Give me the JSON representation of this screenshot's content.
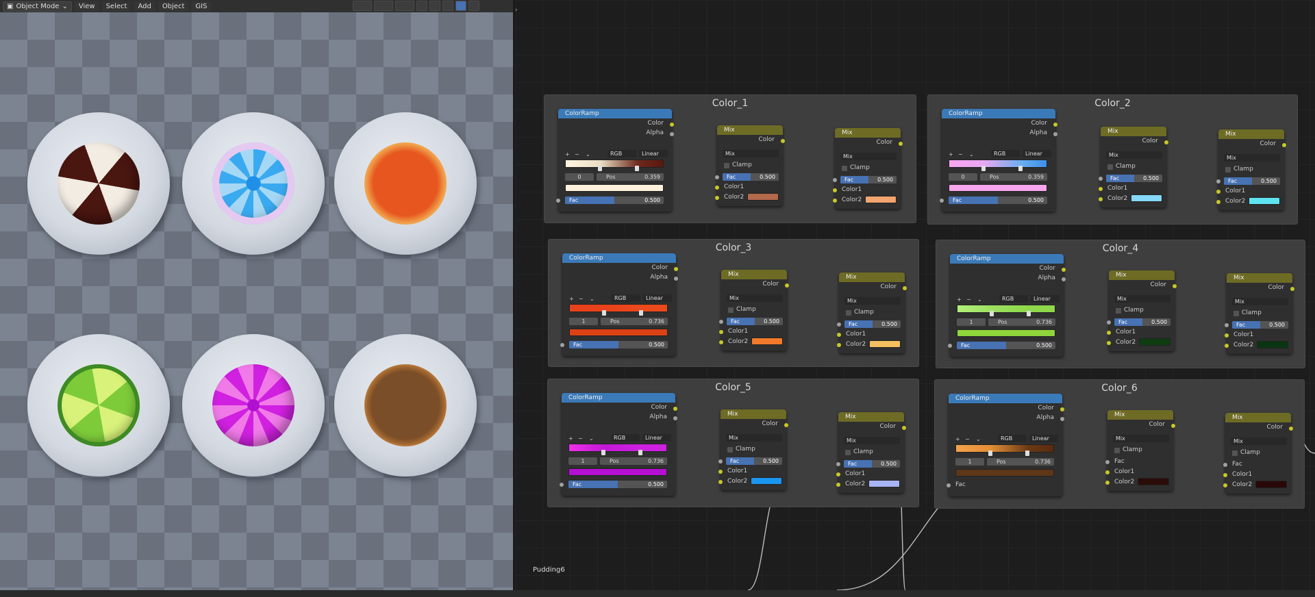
{
  "viewport_header": {
    "mode": "Object Mode",
    "menus": [
      "View",
      "Select",
      "Add",
      "Object",
      "GIS"
    ]
  },
  "node_tree_name": "Pudding6",
  "frames": [
    {
      "label": "Color_1",
      "ramp": {
        "color_mode": "RGB",
        "interp": "Linear",
        "index": "0",
        "pos": "0.359",
        "fac": "0.500",
        "gradient": [
          "#fff4df",
          "#e9ddc4",
          "#6e2a1e",
          "#5a1710"
        ],
        "output": "#fff2dc"
      },
      "mix1": {
        "blend": "Mix",
        "fac": "0.500",
        "color2": "#b4694a"
      },
      "mix2": {
        "blend": "Mix",
        "fac": "0.500",
        "color2": "#f2a56f"
      }
    },
    {
      "label": "Color_2",
      "ramp": {
        "color_mode": "RGB",
        "interp": "Linear",
        "index": "0",
        "pos": "0.359",
        "fac": "0.500",
        "gradient": [
          "#f7a6ee",
          "#e8a8f0",
          "#6aaef0",
          "#3c8fe8"
        ],
        "output": "#f7a6ee"
      },
      "mix1": {
        "blend": "Mix",
        "fac": "0.500",
        "color2": "#86d8f8"
      },
      "mix2": {
        "blend": "Mix",
        "fac": "0.500",
        "color2": "#5ee4f0"
      }
    },
    {
      "label": "Color_3",
      "ramp": {
        "color_mode": "RGB",
        "interp": "Linear",
        "index": "1",
        "pos": "0.736",
        "fac": "0.500",
        "gradient": [
          "#e8421a",
          "#e8421a",
          "#ea4a1c",
          "#ea4a1c"
        ],
        "output": "#db4216"
      },
      "mix1": {
        "blend": "Mix",
        "fac": "0.500",
        "color2": "#f07a2a"
      },
      "mix2": {
        "blend": "Mix",
        "fac": "0.500",
        "color2": "#f5c060"
      }
    },
    {
      "label": "Color_4",
      "ramp": {
        "color_mode": "RGB",
        "interp": "Linear",
        "index": "1",
        "pos": "0.736",
        "fac": "0.500",
        "gradient": [
          "#b2f07a",
          "#9de060",
          "#8ed84a",
          "#8ed84a"
        ],
        "output": "#8fd63c"
      },
      "mix1": {
        "blend": "Mix",
        "fac": "0.500",
        "color2": "#0f3d12"
      },
      "mix2": {
        "blend": "Mix",
        "fac": "0.500",
        "color2": "#0a3512"
      }
    },
    {
      "label": "Color_5",
      "ramp": {
        "color_mode": "RGB",
        "interp": "Linear",
        "index": "1",
        "pos": "0.736",
        "fac": "0.500",
        "gradient": [
          "#f030e8",
          "#c218d6",
          "#cd20e0",
          "#cd20e0"
        ],
        "output": "#b40fd2"
      },
      "mix1": {
        "blend": "Mix",
        "fac": "0.500",
        "color2": "#1a95f0"
      },
      "mix2": {
        "blend": "Mix",
        "fac": "0.500",
        "color2": "#a8b4f5"
      }
    },
    {
      "label": "Color_6",
      "ramp": {
        "color_mode": "RGB",
        "interp": "Linear",
        "index": "1",
        "pos": "0.736",
        "fac_label": "Fac",
        "gradient": [
          "#f5a24a",
          "#e48e36",
          "#6b3a14",
          "#5a2a0e"
        ],
        "output": "#5e3718"
      },
      "mix1": {
        "blend": "Mix",
        "fac_label": "Fac",
        "color2": "#2a0c08"
      },
      "mix2": {
        "blend": "Mix",
        "fac_label": "Fac",
        "color2": "#2a0808"
      }
    }
  ],
  "labels": {
    "color": "Color",
    "alpha": "Alpha",
    "fac": "Fac",
    "pos": "Pos",
    "clamp": "Clamp",
    "color1": "Color1",
    "color2": "Color2",
    "ramp_title": "ColorRamp",
    "mix_title": "Mix",
    "plus": "+",
    "minus": "−",
    "chev": "⌄"
  },
  "candies": [
    {
      "name": "chocolate-swirl",
      "colors": [
        "#f2ece3",
        "#4a1610"
      ]
    },
    {
      "name": "blue-flower",
      "colors": [
        "#e6c9f0",
        "#3aaaf0"
      ]
    },
    {
      "name": "orange",
      "colors": [
        "#f5c27a",
        "#e6561e"
      ]
    },
    {
      "name": "green-swirl",
      "colors": [
        "#d8f27a",
        "#4c9a2c"
      ]
    },
    {
      "name": "magenta-flower",
      "colors": [
        "#f07ae8",
        "#d020e0"
      ]
    },
    {
      "name": "caramel",
      "colors": [
        "#f0b870",
        "#7a4e28"
      ]
    }
  ]
}
